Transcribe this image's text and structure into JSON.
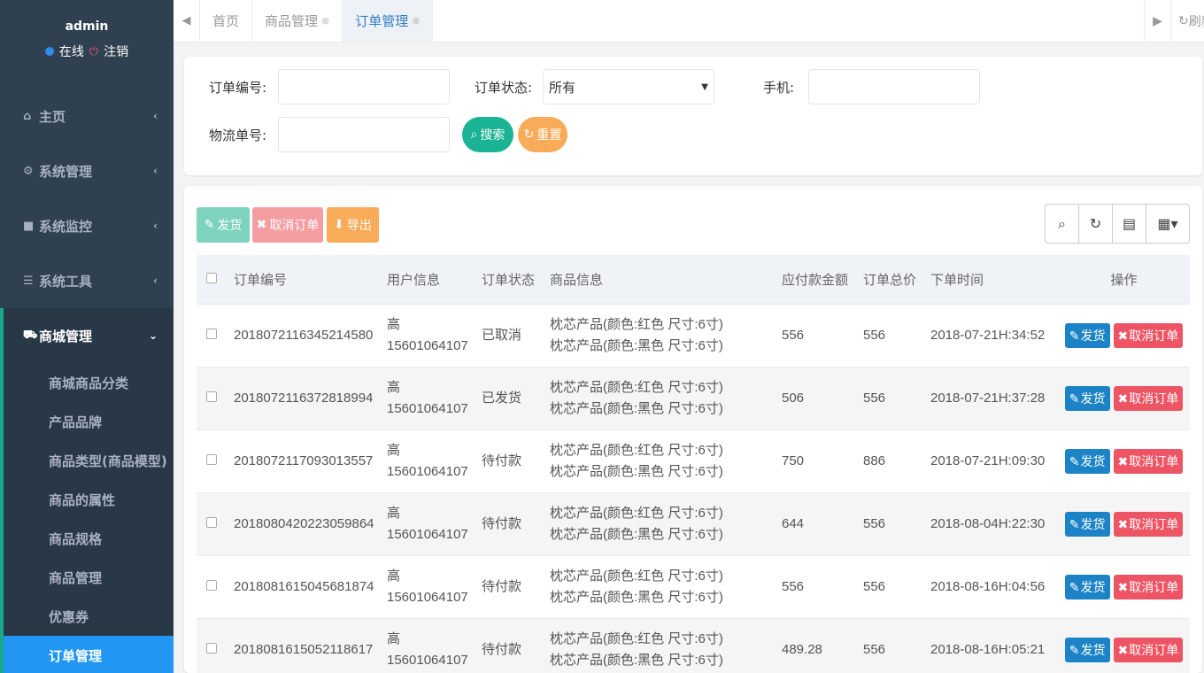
{
  "sidebar": {
    "username": "admin",
    "online_label": "在线",
    "logout_label": "注销",
    "menu": [
      {
        "label": "主页",
        "icon": "home-icon"
      },
      {
        "label": "系统管理",
        "icon": "gear-icon"
      },
      {
        "label": "系统监控",
        "icon": "video-icon"
      },
      {
        "label": "系统工具",
        "icon": "bars-icon"
      },
      {
        "label": "商城管理",
        "icon": "cart-icon"
      }
    ],
    "submenu": [
      "商城商品分类",
      "产品品牌",
      "商品类型(商品模型)",
      "商品的属性",
      "商品规格",
      "商品管理",
      "优惠券",
      "订单管理"
    ]
  },
  "tabs": {
    "items": [
      "首页",
      "商品管理",
      "订单管理"
    ],
    "refresh_label": "刷新"
  },
  "search": {
    "order_no_label": "订单编号:",
    "order_no_value": "",
    "status_label": "订单状态:",
    "status_value": "所有",
    "phone_label": "手机:",
    "phone_value": "",
    "logistics_label": "物流单号:",
    "logistics_value": "",
    "search_button": "搜索",
    "reset_button": "重置"
  },
  "toolbar": {
    "ship": "发货",
    "cancel": "取消订单",
    "export": "导出"
  },
  "table": {
    "headers": [
      "订单编号",
      "用户信息",
      "订单状态",
      "商品信息",
      "应付款金额",
      "订单总价",
      "下单时间",
      "操作"
    ],
    "rows": [
      {
        "order_no": "2018072116345214580",
        "user_name": "高",
        "user_phone": "15601064107",
        "status": "已取消",
        "product1": "枕芯产品(颜色:红色 尺寸:6寸)",
        "product2": "枕芯产品(颜色:黑色 尺寸:6寸)",
        "payable": "556",
        "total": "556",
        "time": "2018-07-21H:34:52",
        "ship": "发货",
        "cancel": "取消订单"
      },
      {
        "order_no": "2018072116372818994",
        "user_name": "高",
        "user_phone": "15601064107",
        "status": "已发货",
        "product1": "枕芯产品(颜色:红色 尺寸:6寸)",
        "product2": "枕芯产品(颜色:黑色 尺寸:6寸)",
        "payable": "506",
        "total": "556",
        "time": "2018-07-21H:37:28",
        "ship": "发货",
        "cancel": "取消订单"
      },
      {
        "order_no": "2018072117093013557",
        "user_name": "高",
        "user_phone": "15601064107",
        "status": "待付款",
        "product1": "枕芯产品(颜色:红色 尺寸:6寸)",
        "product2": "枕芯产品(颜色:黑色 尺寸:6寸)",
        "payable": "750",
        "total": "886",
        "time": "2018-07-21H:09:30",
        "ship": "发货",
        "cancel": "取消订单"
      },
      {
        "order_no": "2018080420223059864",
        "user_name": "高",
        "user_phone": "15601064107",
        "status": "待付款",
        "product1": "枕芯产品(颜色:红色 尺寸:6寸)",
        "product2": "枕芯产品(颜色:黑色 尺寸:6寸)",
        "payable": "644",
        "total": "556",
        "time": "2018-08-04H:22:30",
        "ship": "发货",
        "cancel": "取消订单"
      },
      {
        "order_no": "2018081615045681874",
        "user_name": "高",
        "user_phone": "15601064107",
        "status": "待付款",
        "product1": "枕芯产品(颜色:红色 尺寸:6寸)",
        "product2": "枕芯产品(颜色:黑色 尺寸:6寸)",
        "payable": "556",
        "total": "556",
        "time": "2018-08-16H:04:56",
        "ship": "发货",
        "cancel": "取消订单"
      },
      {
        "order_no": "2018081615052118617",
        "user_name": "高",
        "user_phone": "15601064107",
        "status": "待付款",
        "product1": "枕芯产品(颜色:红色 尺寸:6寸)",
        "product2": "枕芯产品(颜色:黑色 尺寸:6寸)",
        "payable": "489.28",
        "total": "556",
        "time": "2018-08-16H:05:21",
        "ship": "发货",
        "cancel": "取消订单"
      }
    ]
  },
  "colors": {
    "sidebar_bg": "#2f4050",
    "active_submenu": "#2196f3",
    "primary_green": "#1ab394",
    "warning_orange": "#f8ac59",
    "danger_red": "#ed5565",
    "info_blue": "#1c84c6"
  }
}
